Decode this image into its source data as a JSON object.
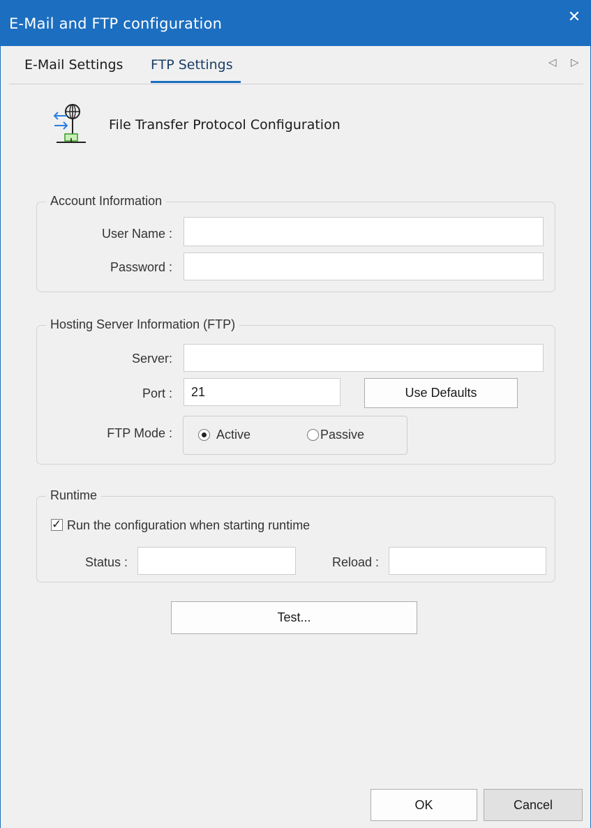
{
  "window": {
    "title": "E-Mail and FTP configuration",
    "close_glyph": "✕"
  },
  "tabs": [
    {
      "label": "E-Mail Settings",
      "active": false
    },
    {
      "label": "FTP Settings",
      "active": true
    }
  ],
  "tab_scroll": {
    "left_glyph": "◁",
    "right_glyph": "▷"
  },
  "header": {
    "icon": "ftp-network-icon",
    "text": "File Transfer Protocol Configuration"
  },
  "account": {
    "legend": "Account Information",
    "username_label": "User Name :",
    "username_value": "",
    "password_label": "Password :",
    "password_value": ""
  },
  "server": {
    "legend": "Hosting Server Information (FTP)",
    "server_label": "Server:",
    "server_value": "",
    "port_label": "Port :",
    "port_value": "21",
    "use_defaults_label": "Use Defaults",
    "mode_label": "FTP Mode :",
    "mode_options": [
      {
        "label": "Active",
        "selected": true
      },
      {
        "label": "Passive",
        "selected": false
      }
    ]
  },
  "runtime": {
    "legend": "Runtime",
    "run_checkbox_label": "Run the configuration when starting runtime",
    "run_checked": true,
    "status_label": "Status :",
    "status_value": "",
    "reload_label": "Reload :",
    "reload_value": ""
  },
  "test_button_label": "Test...",
  "footer": {
    "ok_label": "OK",
    "cancel_label": "Cancel"
  },
  "colors": {
    "titlebar": "#1c6ec0",
    "tab_underline": "#1c6ec0",
    "background": "#f0f0f0"
  }
}
